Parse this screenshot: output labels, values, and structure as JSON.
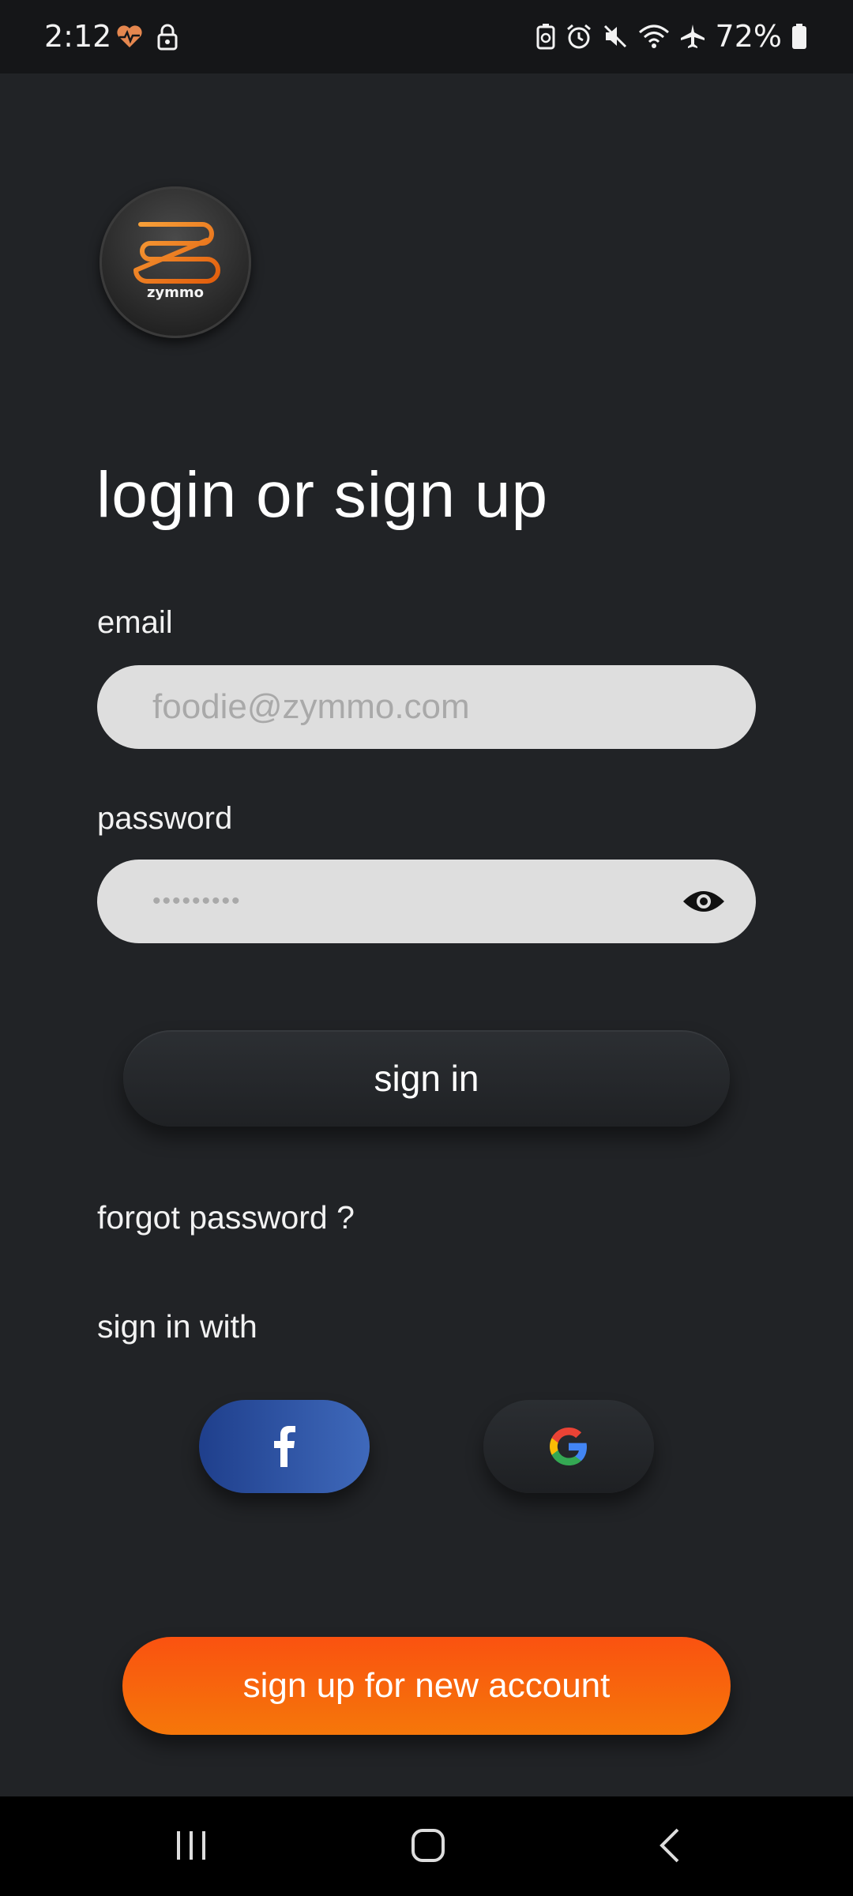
{
  "status_bar": {
    "time": "2:12",
    "battery": "72%",
    "icons": [
      "heart-rate-icon",
      "lock-icon",
      "battery-saver-icon",
      "alarm-icon",
      "mute-icon",
      "wifi-icon",
      "airplane-icon",
      "battery-icon"
    ]
  },
  "logo": {
    "text": "zymmo"
  },
  "page": {
    "title": "login or sign up"
  },
  "form": {
    "email_label": "email",
    "email_placeholder": "foodie@zymmo.com",
    "password_label": "password",
    "password_value": "•••••••••"
  },
  "actions": {
    "sign_in": "sign in",
    "forgot_password": "forgot password ?",
    "sign_in_with": "sign in with",
    "sign_up": "sign up for new account"
  },
  "colors": {
    "background": "#212326",
    "accent": "#f5620c",
    "facebook": "#2f55a6"
  }
}
